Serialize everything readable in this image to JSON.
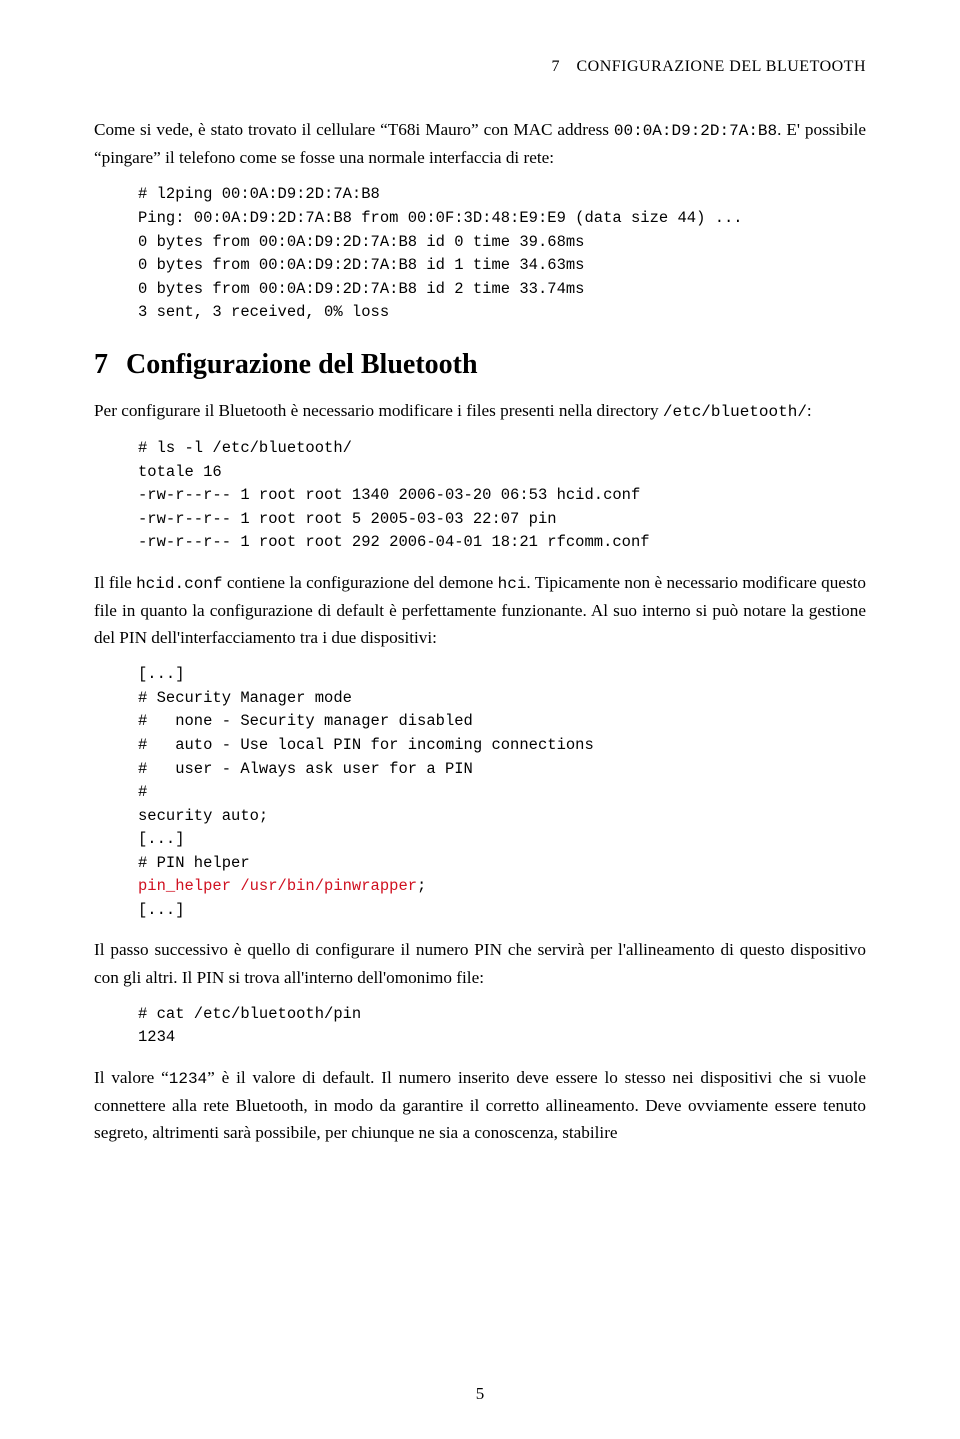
{
  "header": {
    "running_head": "7 CONFIGURAZIONE DEL BLUETOOTH"
  },
  "para1": {
    "t1": "Come si vede, è stato trovato il cellulare “T68i Mauro” con MAC address ",
    "mac": "00:0A:D9:2D:7A:B8",
    "t2": ". E' possibile “pingare” il telefono come se fosse una normale interfaccia di rete:"
  },
  "code1": "# l2ping 00:0A:D9:2D:7A:B8\nPing: 00:0A:D9:2D:7A:B8 from 00:0F:3D:48:E9:E9 (data size 44) ...\n0 bytes from 00:0A:D9:2D:7A:B8 id 0 time 39.68ms\n0 bytes from 00:0A:D9:2D:7A:B8 id 1 time 34.63ms\n0 bytes from 00:0A:D9:2D:7A:B8 id 2 time 33.74ms\n3 sent, 3 received, 0% loss",
  "section": {
    "num": "7",
    "title": "Configurazione del Bluetooth"
  },
  "para2": {
    "t1": "Per configurare il Bluetooth è necessario modificare i files presenti nella directory ",
    "path": "/etc/bluetooth/",
    "t2": ":"
  },
  "code2": "# ls -l /etc/bluetooth/\ntotale 16\n-rw-r--r-- 1 root root 1340 2006-03-20 06:53 hcid.conf\n-rw-r--r-- 1 root root 5 2005-03-03 22:07 pin\n-rw-r--r-- 1 root root 292 2006-04-01 18:21 rfcomm.conf",
  "para3": {
    "t1": "Il file ",
    "c1": "hcid.conf",
    "t2": " contiene la configurazione del demone ",
    "c2": "hci",
    "t3": ". Tipicamente non è necessario modificare questo file in quanto la configurazione di default è perfettamente funzionante. Al suo interno si può notare la gestione del PIN dell'interfacciamento tra i due dispositivi:"
  },
  "code3a": "[...]\n# Security Manager mode\n#   none - Security manager disabled\n#   auto - Use local PIN for incoming connections\n#   user - Always ask user for a PIN\n#\nsecurity auto;\n[...]\n# PIN helper\n",
  "code3red": "pin_helper /usr/bin/pinwrapper",
  "code3b": ";\n[...]",
  "para4": "Il passo successivo è quello di configurare il numero PIN che servirà per l'allineamento di questo dispositivo con gli altri. Il PIN si trova all'interno dell'omonimo file:",
  "code4": "# cat /etc/bluetooth/pin\n1234",
  "para5": {
    "t1": "Il valore “",
    "c1": "1234",
    "t2": "” è il valore di default. Il numero inserito deve essere lo stesso nei dispositivi che si vuole connettere alla rete Bluetooth, in modo da garantire il corretto allineamento. Deve ovviamente essere tenuto segreto, altrimenti sarà possibile, per chiunque ne sia a conoscenza, stabilire"
  },
  "pagenum": "5"
}
